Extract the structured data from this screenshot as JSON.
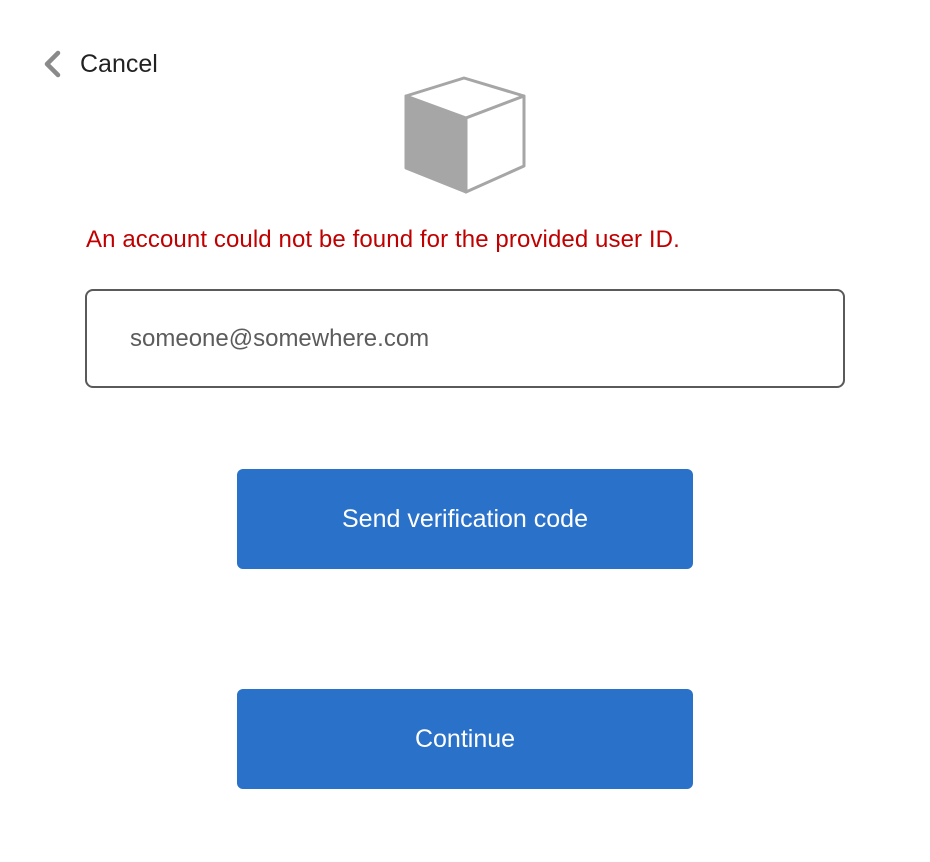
{
  "nav": {
    "cancel_label": "Cancel",
    "back_icon": "chevron-left-icon"
  },
  "logo": {
    "icon": "cube-icon"
  },
  "error": {
    "message": "An account could not be found for the provided user ID."
  },
  "email": {
    "value": "",
    "placeholder": "someone@somewhere.com"
  },
  "actions": {
    "send_code_label": "Send verification code",
    "continue_label": "Continue"
  },
  "colors": {
    "primary": "#2a71c9",
    "error": "#c00000",
    "border": "#5a5a5a"
  }
}
